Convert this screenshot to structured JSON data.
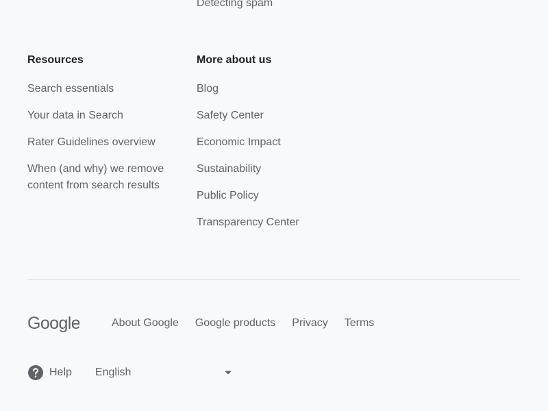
{
  "top_partial_link": "Detecting spam",
  "resources": {
    "heading": "Resources",
    "links": [
      "Search essentials",
      "Your data in Search",
      "Rater Guidelines overview",
      "When (and why) we remove content from search results"
    ]
  },
  "more_about_us": {
    "heading": "More about us",
    "links": [
      "Blog",
      "Safety Center",
      "Economic Impact",
      "Sustainability",
      "Public Policy",
      "Transparency Center"
    ]
  },
  "footer": {
    "logo_text": "Google",
    "links": [
      "About Google",
      "Google products",
      "Privacy",
      "Terms"
    ],
    "help_label": "Help",
    "help_icon": "help-circle-icon",
    "language": "English",
    "language_icon": "caret-down-icon"
  },
  "colors": {
    "background": "#f8f9fa",
    "text": "#5f6368",
    "heading": "#202124",
    "divider": "#dadce0"
  }
}
